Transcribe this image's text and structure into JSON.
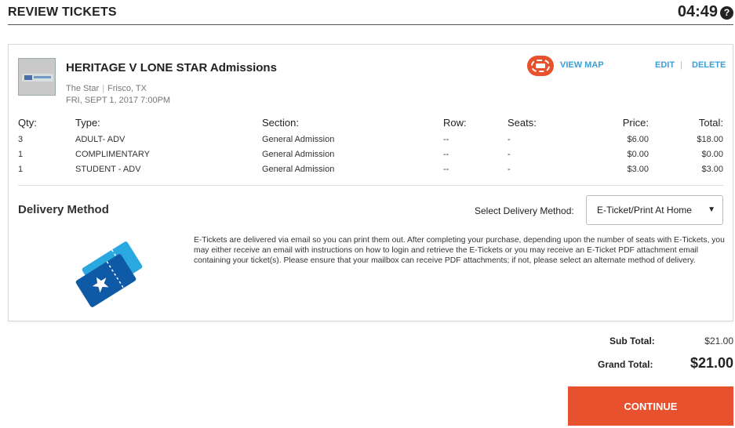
{
  "header": {
    "title": "REVIEW TICKETS",
    "timer": "04:49",
    "help_glyph": "?"
  },
  "event": {
    "title": "HERITAGE V LONE STAR Admissions",
    "venue": "The Star",
    "city": "Frisco, TX",
    "venue_separator": "|",
    "date": "FRI, SEPT 1, 2017 7:00PM",
    "view_map_label": "VIEW MAP",
    "edit_label": "EDIT",
    "delete_label": "DELETE",
    "link_separator": "|"
  },
  "tickets": {
    "headers": {
      "qty": "Qty:",
      "type": "Type:",
      "section": "Section:",
      "row": "Row:",
      "seats": "Seats:",
      "price": "Price:",
      "total": "Total:"
    },
    "rows": [
      {
        "qty": "3",
        "type": "ADULT- ADV",
        "section": "General Admission",
        "row": "--",
        "seats": "-",
        "price": "$6.00",
        "total": "$18.00"
      },
      {
        "qty": "1",
        "type": "COMPLIMENTARY",
        "section": "General Admission",
        "row": "--",
        "seats": "-",
        "price": "$0.00",
        "total": "$0.00"
      },
      {
        "qty": "1",
        "type": "STUDENT - ADV",
        "section": "General Admission",
        "row": "--",
        "seats": "-",
        "price": "$3.00",
        "total": "$3.00"
      }
    ]
  },
  "delivery": {
    "title": "Delivery Method",
    "select_label": "Select Delivery Method:",
    "selected": "E-Ticket/Print At Home",
    "description": "E-Tickets are delivered via email so you can print them out.  After completing your purchase, depending upon the number of seats with E-Tickets, you may either receive an email with instructions on how to login and retrieve the E-Tickets or you may receive an E-Ticket PDF attachment email containing your ticket(s).  Please ensure that your mailbox can receive PDF attachments; if not, please select an alternate method of delivery."
  },
  "summary": {
    "subtotal_label": "Sub Total:",
    "subtotal_value": "$21.00",
    "grand_label": "Grand Total:",
    "grand_value": "$21.00"
  },
  "continue_label": "CONTINUE",
  "colors": {
    "accent": "#e8512d",
    "link": "#3a9fd6",
    "ticket_dark": "#0e5aa7",
    "ticket_light": "#2aa8e0"
  }
}
